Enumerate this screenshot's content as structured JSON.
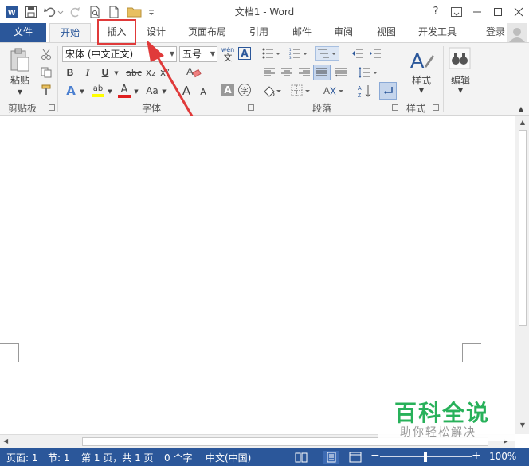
{
  "title": "文档1 - Word",
  "window_controls": {
    "help": "?",
    "ribbon_display": "⊡",
    "minimize": "—",
    "maximize": "☐",
    "close": "✕"
  },
  "tabs": {
    "file": "文件",
    "home": "开始",
    "insert": "插入",
    "design": "设计",
    "layout": "页面布局",
    "references": "引用",
    "mailings": "邮件",
    "review": "审阅",
    "view": "视图",
    "developer": "开发工具"
  },
  "signin": "登录",
  "ribbon": {
    "clipboard": {
      "label": "剪贴板",
      "paste": "粘贴"
    },
    "font": {
      "label": "字体",
      "font_name": "宋体 (中文正文)",
      "font_size": "五号",
      "phonetic": "wén",
      "phonetic_char": "文",
      "bold": "B",
      "italic": "I",
      "underline": "U",
      "strike": "abc",
      "sub": "x₂",
      "sup": "x²",
      "change_case": "Aa",
      "grow": "A",
      "shrink": "A",
      "char_shading": "A",
      "enclose": "字",
      "highlight": "ab",
      "color": "A"
    },
    "paragraph": {
      "label": "段落"
    },
    "styles": {
      "label": "样式",
      "button": "样式"
    },
    "editing": {
      "button": "编辑"
    }
  },
  "watermark": {
    "title": "百科全说",
    "subtitle": "助你轻松解决"
  },
  "status": {
    "page": "页面: 1",
    "section": "节: 1",
    "page_of": "第 1 页，共 1 页",
    "words": "0 个字",
    "language": "中文(中国)",
    "zoom_minus": "−",
    "zoom_plus": "+",
    "zoom": "100%"
  },
  "colors": {
    "accent": "#2b579a",
    "callout": "#e03a3a",
    "watermark": "#28b15a"
  }
}
